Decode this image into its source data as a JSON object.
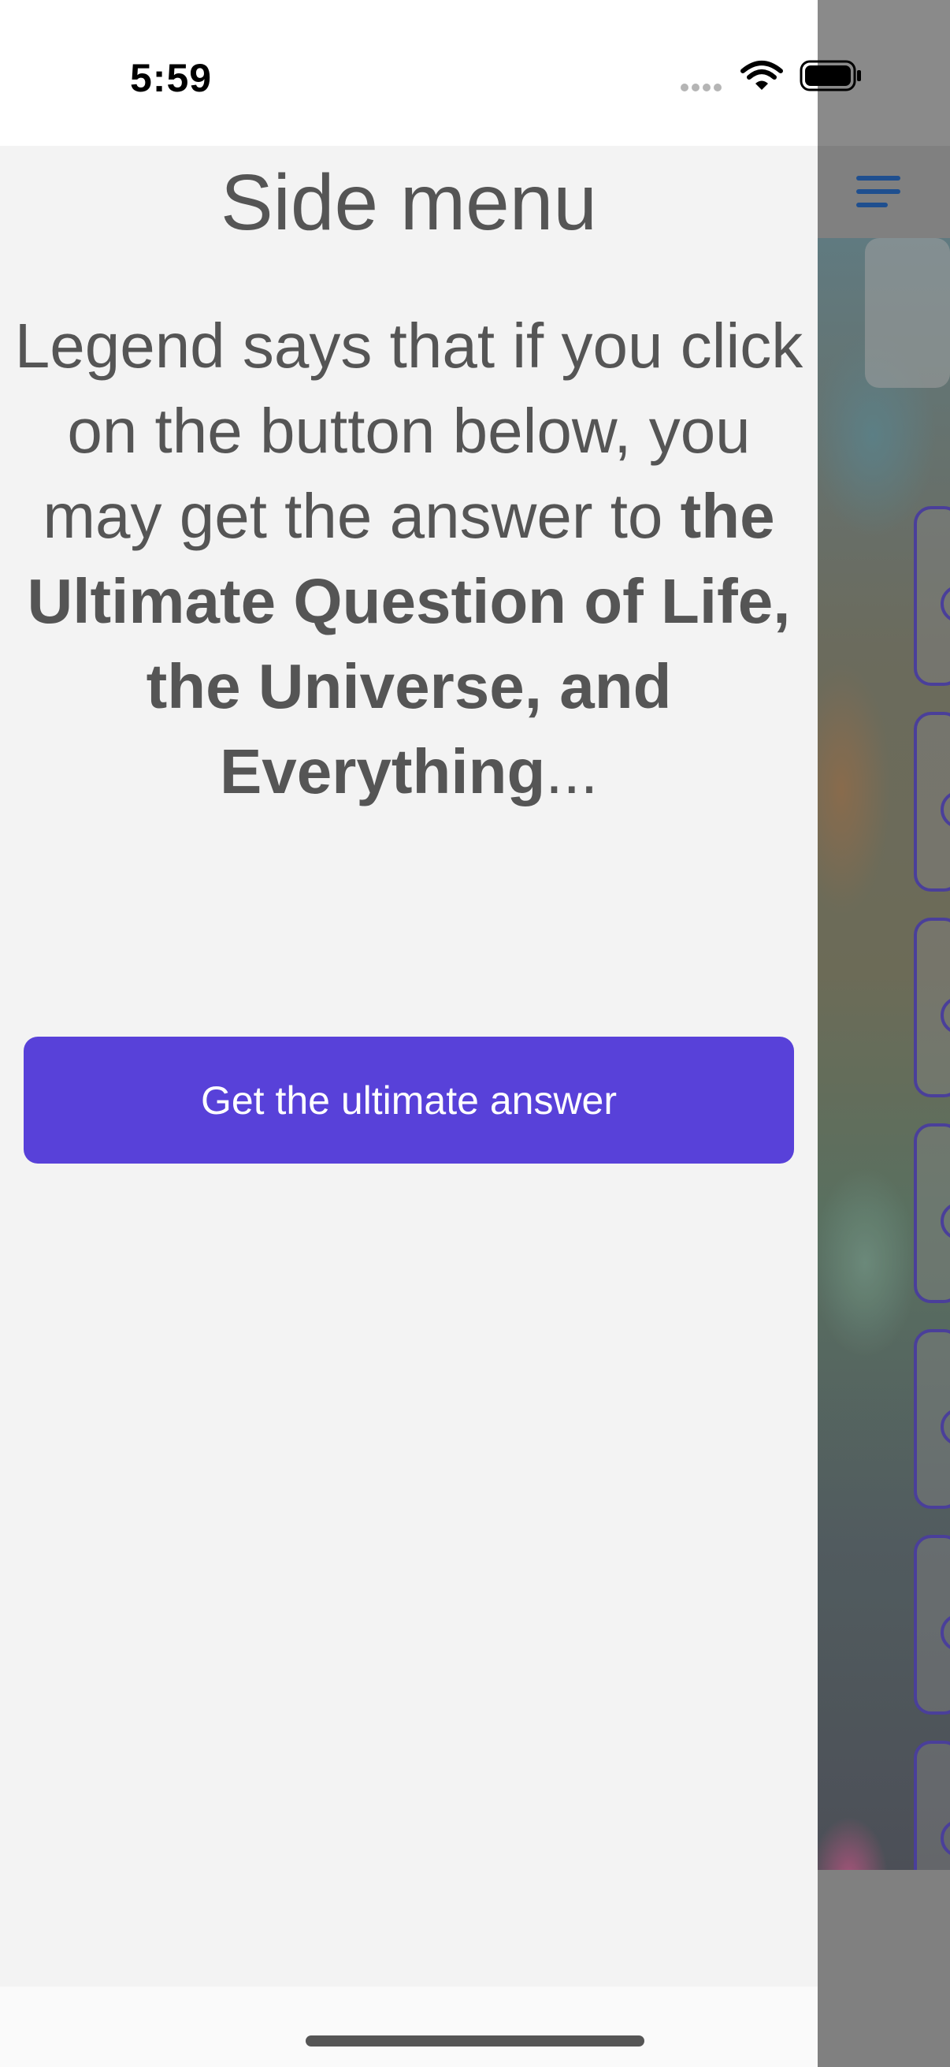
{
  "status_bar": {
    "time": "5:59"
  },
  "side_menu": {
    "title": "Side menu",
    "legend_intro": "Legend says that if you click on the button below, you may get the answer to ",
    "legend_bold": "the Ultimate Question of Life, the Universe, and Everything",
    "legend_ellipsis": "...",
    "button_label": "Get the ultimate answer"
  },
  "colors": {
    "button_bg": "#5841d9",
    "drawer_bg": "#f3f3f3",
    "text": "#555555",
    "menu_icon": "#1f4f8f"
  },
  "background_app": {
    "menu_icon": "hamburger-menu-icon"
  }
}
